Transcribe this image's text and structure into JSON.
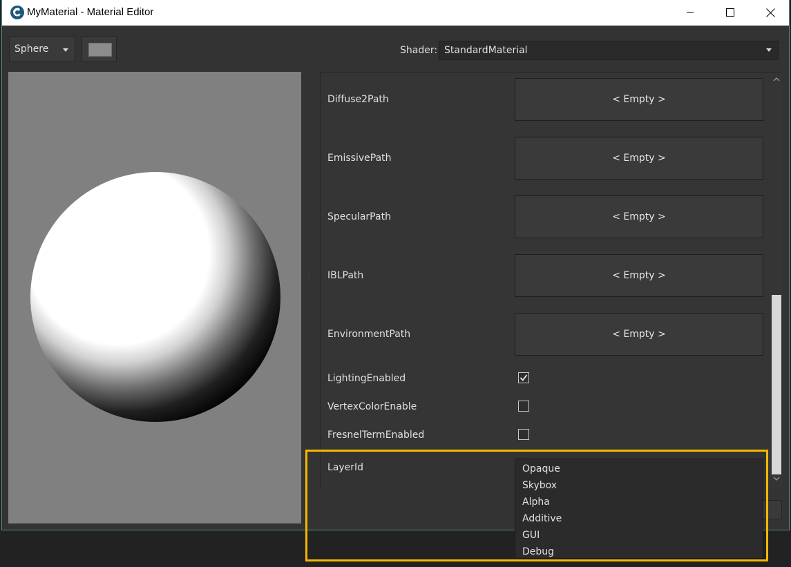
{
  "window": {
    "title": "MyMaterial - Material Editor",
    "controls": [
      "minimize",
      "maximize",
      "close"
    ]
  },
  "toolbar": {
    "mesh_select_value": "Sphere",
    "color_swatch": "#8c8c8c",
    "shader_label": "Shader:",
    "shader_value": "StandardMaterial"
  },
  "properties": {
    "path_rows": [
      {
        "label": "Diffuse2Path",
        "value": "< Empty >"
      },
      {
        "label": "EmissivePath",
        "value": "< Empty >"
      },
      {
        "label": "SpecularPath",
        "value": "< Empty >"
      },
      {
        "label": "IBLPath",
        "value": "< Empty >"
      },
      {
        "label": "EnvironmentPath",
        "value": "< Empty >"
      }
    ],
    "checkbox_rows": [
      {
        "label": "LightingEnabled",
        "checked": true
      },
      {
        "label": "VertexColorEnable",
        "checked": false
      },
      {
        "label": "FresnelTermEnabled",
        "checked": false
      }
    ],
    "layer_label": "LayerId",
    "layer_options": [
      "Opaque",
      "Skybox",
      "Alpha",
      "Additive",
      "GUI",
      "Debug"
    ]
  },
  "colors": {
    "highlight": "#f5b800",
    "panel": "#333333",
    "preview_bg": "#808080"
  }
}
